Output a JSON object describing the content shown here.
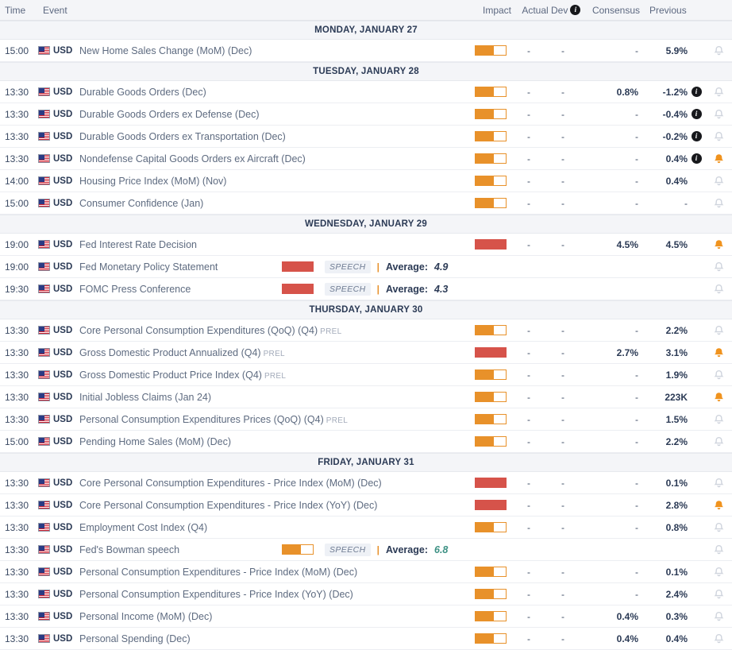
{
  "header": {
    "time": "Time",
    "event": "Event",
    "impact": "Impact",
    "actual": "Actual",
    "dev": "Dev",
    "dev_info_icon": "i",
    "consensus": "Consensus",
    "previous": "Previous"
  },
  "labels": {
    "speech": "SPEECH",
    "average": "Average:",
    "pipe": "|",
    "prel": "PREL",
    "currency": "USD",
    "dash": "-"
  },
  "colors": {
    "impact_medium": "#e8912a",
    "impact_high": "#d6534a",
    "bell_on": "#f0931e",
    "bell_off": "#cfd4dd",
    "day_header_bg": "#f4f5f8",
    "green_value": "#3d9184"
  },
  "days": [
    {
      "title": "MONDAY, JANUARY 27",
      "rows": [
        {
          "time": "15:00",
          "currency": "USD",
          "event": "New Home Sales Change (MoM) (Dec)",
          "prel": "",
          "impact": "medium",
          "impact_fill": 60,
          "type": "data",
          "actual": "-",
          "dev": "-",
          "consensus": "-",
          "previous": "5.9%",
          "info": false,
          "bell": false
        }
      ]
    },
    {
      "title": "TUESDAY, JANUARY 28",
      "rows": [
        {
          "time": "13:30",
          "currency": "USD",
          "event": "Durable Goods Orders (Dec)",
          "prel": "",
          "impact": "medium",
          "impact_fill": 60,
          "type": "data",
          "actual": "-",
          "dev": "-",
          "consensus": "0.8%",
          "previous": "-1.2%",
          "info": true,
          "bell": false
        },
        {
          "time": "13:30",
          "currency": "USD",
          "event": "Durable Goods Orders ex Defense (Dec)",
          "prel": "",
          "impact": "medium",
          "impact_fill": 60,
          "type": "data",
          "actual": "-",
          "dev": "-",
          "consensus": "-",
          "previous": "-0.4%",
          "info": true,
          "bell": false
        },
        {
          "time": "13:30",
          "currency": "USD",
          "event": "Durable Goods Orders ex Transportation (Dec)",
          "prel": "",
          "impact": "medium",
          "impact_fill": 60,
          "type": "data",
          "actual": "-",
          "dev": "-",
          "consensus": "-",
          "previous": "-0.2%",
          "info": true,
          "bell": false
        },
        {
          "time": "13:30",
          "currency": "USD",
          "event": "Nondefense Capital Goods Orders ex Aircraft (Dec)",
          "prel": "",
          "impact": "medium",
          "impact_fill": 60,
          "type": "data",
          "actual": "-",
          "dev": "-",
          "consensus": "-",
          "previous": "0.4%",
          "info": true,
          "bell": true
        },
        {
          "time": "14:00",
          "currency": "USD",
          "event": "Housing Price Index (MoM) (Nov)",
          "prel": "",
          "impact": "medium",
          "impact_fill": 60,
          "type": "data",
          "actual": "-",
          "dev": "-",
          "consensus": "-",
          "previous": "0.4%",
          "info": false,
          "bell": false
        },
        {
          "time": "15:00",
          "currency": "USD",
          "event": "Consumer Confidence (Jan)",
          "prel": "",
          "impact": "medium",
          "impact_fill": 60,
          "type": "data",
          "actual": "-",
          "dev": "-",
          "consensus": "-",
          "previous": "-",
          "info": false,
          "bell": false
        }
      ]
    },
    {
      "title": "WEDNESDAY, JANUARY 29",
      "rows": [
        {
          "time": "19:00",
          "currency": "USD",
          "event": "Fed Interest Rate Decision",
          "prel": "",
          "impact": "high",
          "impact_fill": 100,
          "type": "data",
          "actual": "-",
          "dev": "-",
          "consensus": "4.5%",
          "previous": "4.5%",
          "info": false,
          "bell": true
        },
        {
          "time": "19:00",
          "currency": "USD",
          "event": "Fed Monetary Policy Statement",
          "prel": "",
          "impact": "high",
          "impact_fill": 100,
          "type": "speech",
          "average": "4.9",
          "average_green": false,
          "info": false,
          "bell": false
        },
        {
          "time": "19:30",
          "currency": "USD",
          "event": "FOMC Press Conference",
          "prel": "",
          "impact": "high",
          "impact_fill": 100,
          "type": "speech",
          "average": "4.3",
          "average_green": false,
          "info": false,
          "bell": false
        }
      ]
    },
    {
      "title": "THURSDAY, JANUARY 30",
      "rows": [
        {
          "time": "13:30",
          "currency": "USD",
          "event": "Core Personal Consumption Expenditures (QoQ) (Q4)",
          "prel": "PREL",
          "impact": "medium",
          "impact_fill": 60,
          "type": "data",
          "actual": "-",
          "dev": "-",
          "consensus": "-",
          "previous": "2.2%",
          "info": false,
          "bell": false
        },
        {
          "time": "13:30",
          "currency": "USD",
          "event": "Gross Domestic Product Annualized (Q4)",
          "prel": "PREL",
          "impact": "high",
          "impact_fill": 100,
          "type": "data",
          "actual": "-",
          "dev": "-",
          "consensus": "2.7%",
          "previous": "3.1%",
          "info": false,
          "bell": true
        },
        {
          "time": "13:30",
          "currency": "USD",
          "event": "Gross Domestic Product Price Index (Q4)",
          "prel": "PREL",
          "impact": "medium",
          "impact_fill": 60,
          "type": "data",
          "actual": "-",
          "dev": "-",
          "consensus": "-",
          "previous": "1.9%",
          "info": false,
          "bell": false
        },
        {
          "time": "13:30",
          "currency": "USD",
          "event": "Initial Jobless Claims (Jan 24)",
          "prel": "",
          "impact": "medium",
          "impact_fill": 60,
          "type": "data",
          "actual": "-",
          "dev": "-",
          "consensus": "-",
          "previous": "223K",
          "info": false,
          "bell": true
        },
        {
          "time": "13:30",
          "currency": "USD",
          "event": "Personal Consumption Expenditures Prices (QoQ) (Q4)",
          "prel": "PREL",
          "impact": "medium",
          "impact_fill": 60,
          "type": "data",
          "actual": "-",
          "dev": "-",
          "consensus": "-",
          "previous": "1.5%",
          "info": false,
          "bell": false
        },
        {
          "time": "15:00",
          "currency": "USD",
          "event": "Pending Home Sales (MoM) (Dec)",
          "prel": "",
          "impact": "medium",
          "impact_fill": 60,
          "type": "data",
          "actual": "-",
          "dev": "-",
          "consensus": "-",
          "previous": "2.2%",
          "info": false,
          "bell": false
        }
      ]
    },
    {
      "title": "FRIDAY, JANUARY 31",
      "rows": [
        {
          "time": "13:30",
          "currency": "USD",
          "event": "Core Personal Consumption Expenditures - Price Index (MoM) (Dec)",
          "prel": "",
          "impact": "high",
          "impact_fill": 100,
          "type": "data",
          "actual": "-",
          "dev": "-",
          "consensus": "-",
          "previous": "0.1%",
          "info": false,
          "bell": false
        },
        {
          "time": "13:30",
          "currency": "USD",
          "event": "Core Personal Consumption Expenditures - Price Index (YoY) (Dec)",
          "prel": "",
          "impact": "high",
          "impact_fill": 100,
          "type": "data",
          "actual": "-",
          "dev": "-",
          "consensus": "-",
          "previous": "2.8%",
          "info": false,
          "bell": true
        },
        {
          "time": "13:30",
          "currency": "USD",
          "event": "Employment Cost Index (Q4)",
          "prel": "",
          "impact": "medium",
          "impact_fill": 60,
          "type": "data",
          "actual": "-",
          "dev": "-",
          "consensus": "-",
          "previous": "0.8%",
          "info": false,
          "bell": false
        },
        {
          "time": "13:30",
          "currency": "USD",
          "event": "Fed's Bowman speech",
          "prel": "",
          "impact": "medium",
          "impact_fill": 60,
          "type": "speech",
          "average": "6.8",
          "average_green": true,
          "info": false,
          "bell": false
        },
        {
          "time": "13:30",
          "currency": "USD",
          "event": "Personal Consumption Expenditures - Price Index (MoM) (Dec)",
          "prel": "",
          "impact": "medium",
          "impact_fill": 60,
          "type": "data",
          "actual": "-",
          "dev": "-",
          "consensus": "-",
          "previous": "0.1%",
          "info": false,
          "bell": false
        },
        {
          "time": "13:30",
          "currency": "USD",
          "event": "Personal Consumption Expenditures - Price Index (YoY) (Dec)",
          "prel": "",
          "impact": "medium",
          "impact_fill": 60,
          "type": "data",
          "actual": "-",
          "dev": "-",
          "consensus": "-",
          "previous": "2.4%",
          "info": false,
          "bell": false
        },
        {
          "time": "13:30",
          "currency": "USD",
          "event": "Personal Income (MoM) (Dec)",
          "prel": "",
          "impact": "medium",
          "impact_fill": 60,
          "type": "data",
          "actual": "-",
          "dev": "-",
          "consensus": "0.4%",
          "previous": "0.3%",
          "info": false,
          "bell": false
        },
        {
          "time": "13:30",
          "currency": "USD",
          "event": "Personal Spending (Dec)",
          "prel": "",
          "impact": "medium",
          "impact_fill": 60,
          "type": "data",
          "actual": "-",
          "dev": "-",
          "consensus": "0.4%",
          "previous": "0.4%",
          "info": false,
          "bell": false
        }
      ]
    }
  ]
}
